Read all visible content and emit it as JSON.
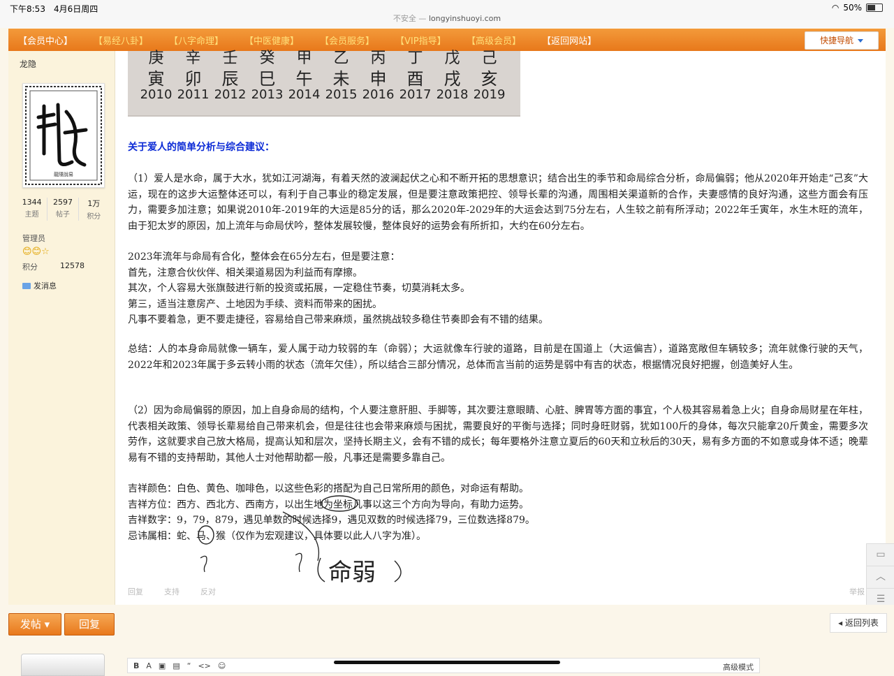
{
  "statusbar": {
    "time": "下午8:53　4月6日周四",
    "url_warning": "不安全 — ",
    "url": "longyinshuoyi.com",
    "battery": "50%"
  },
  "nav": {
    "items": [
      "【会员中心】",
      "【易经八卦】",
      "【八字命理】",
      "【中医健康】",
      "【会员服务】",
      "【VIP指导】",
      "【高级会员】",
      "【返回网站】"
    ],
    "quick_nav": "快捷导航"
  },
  "sidebar": {
    "username": "龙隐",
    "stats": [
      {
        "n": "1344",
        "l": "主题"
      },
      {
        "n": "2597",
        "l": "帖子"
      },
      {
        "n": "1万",
        "l": "积分"
      }
    ],
    "role": "管理员",
    "points_label": "积分",
    "points_value": "12578",
    "message": "发消息",
    "avatar_text": "龍隱說易"
  },
  "ganzhi": {
    "top": [
      "庚",
      "辛",
      "壬",
      "癸",
      "甲",
      "乙",
      "丙",
      "丁",
      "戊",
      "己"
    ],
    "mid": [
      "寅",
      "卯",
      "辰",
      "巳",
      "午",
      "未",
      "申",
      "酉",
      "戌",
      "亥"
    ],
    "years": [
      "2010",
      "2011",
      "2012",
      "2013",
      "2014",
      "2015",
      "2016",
      "2017",
      "2018",
      "2019"
    ]
  },
  "article": {
    "heading": "关于爱人的简单分析与综合建议：",
    "p1": "（1）爱人是水命，属于大水，犹如江河湖海，有着天然的波澜起伏之心和不断开拓的思想意识；结合出生的季节和命局综合分析，命局偏弱；他从2020年开始走“己亥”大运，现在的这步大运整体还可以，有利于自己事业的稳定发展，但是要注意政策把控、领导长辈的沟通，周围相关渠道新的合作，夫妻感情的良好沟通，这些方面会有压力，需要多加注意；如果说2010年-2019年的大运是85分的话，那么2020年-2029年的大运会达到75分左右，人生较之前有所浮动；2022年壬寅年，水生木旺的流年，由于犯太岁的原因，加上流年与命局伏吟，整体发展较慢，整体良好的运势会有所折扣，大约在60分左右。",
    "p2_lines": [
      "2023年流年与命局有合化，整体会在65分左右，但是要注意：",
      "首先，注意合伙伙伴、相关渠道易因为利益而有摩擦。",
      "其次，个人容易大张旗鼓进行新的投资或拓展，一定稳住节奏，切莫消耗太多。",
      "第三，适当注意房产、土地因为手续、资料而带来的困扰。",
      "凡事不要着急，更不要走捷径，容易给自己带来麻烦，虽然挑战较多稳住节奏即会有不错的结果。"
    ],
    "p3": "总结：人的本身命局就像一辆车，爱人属于动力较弱的车（命弱）；大运就像车行驶的道路，目前是在国道上（大运偏吉），道路宽敞但车辆较多；流年就像行驶的天气，2022年和2023年属于多云转小雨的状态（流年欠佳），所以结合三部分情况，总体而言当前的运势是弱中有吉的状态，根据情况良好把握，创造美好人生。",
    "p4": "（2）因为命局偏弱的原因，加上自身命局的结构，个人要注意肝胆、手脚等，其次要注意眼睛、心脏、脾胃等方面的事宜，个人极其容易着急上火；自身命局财星在年柱，代表相关政策、领导长辈易给自己带来机会，但是往往也会带来麻烦与困扰，需要良好的平衡与选择；同时身旺财弱，犹如100斤的身体，每次只能拿20斤黄金，需要多次劳作，这就要求自己放大格局，提高认知和层次，坚持长期主义，会有不错的成长；每年要格外注意立夏后的60天和立秋后的30天，易有多方面的不如意或身体不适；晚辈易有不错的支持帮助，其他人士对他帮助都一般，凡事还是需要多靠自己。",
    "p5_lines": [
      "吉祥颜色：白色、黄色、咖啡色，以这些色彩的搭配为自己日常所用的颜色，对命运有帮助。",
      "吉祥方位：西方、西北方、西南方，以出生地为坐标凡事以这三个方向为导向，有助力运势。",
      "吉祥数字：9，79，879，遇见单数的时候选择9，遇见双数的时候选择79，三位数选择879。",
      "忌讳属相：蛇、马、猴（仅作为宏观建议，具体要以此人八字为准）。"
    ],
    "handwriting": "命弱"
  },
  "post_actions": [
    "回复",
    "支持",
    "反对"
  ],
  "report": "举报",
  "bottom": {
    "post_btn": "发帖",
    "reply_btn": "回复",
    "back_list": "返回列表",
    "editor_mode": "高级模式"
  }
}
